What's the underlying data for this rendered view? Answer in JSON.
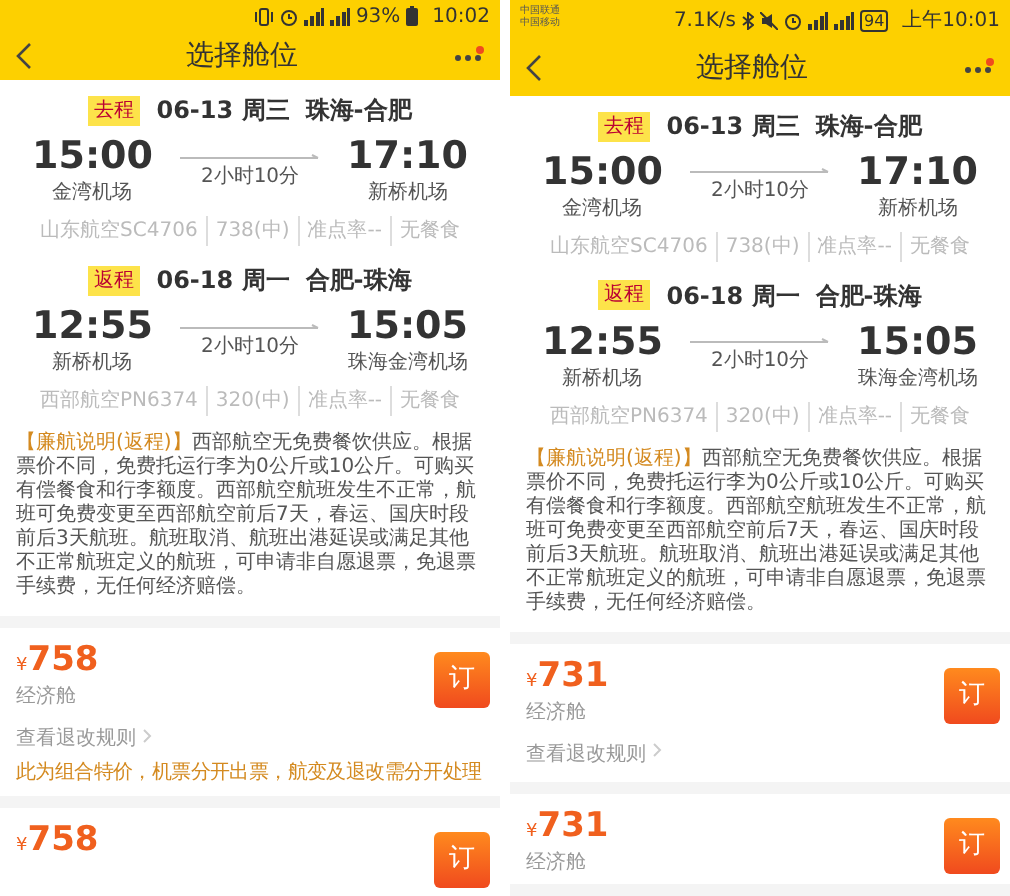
{
  "screens": [
    {
      "status_bar": {
        "kind": "simple",
        "battery": "93%",
        "time": "10:02"
      },
      "title": "选择舱位",
      "notification_dot": true,
      "legs": [
        {
          "tag": "去程",
          "date": "06-13 周三",
          "route": "珠海-合肥",
          "depart_time": "15:00",
          "depart_airport": "金湾机场",
          "duration": "2小时10分",
          "arrive_time": "17:10",
          "arrive_airport": "新桥机场",
          "details": [
            "山东航空SC4706",
            "738(中)",
            "准点率--",
            "无餐食"
          ]
        },
        {
          "tag": "返程",
          "date": "06-18 周一",
          "route": "合肥-珠海",
          "depart_time": "12:55",
          "depart_airport": "新桥机场",
          "duration": "2小时10分",
          "arrive_time": "15:05",
          "arrive_airport": "珠海金湾机场",
          "details": [
            "西部航空PN6374",
            "320(中)",
            "准点率--",
            "无餐食"
          ]
        }
      ],
      "notice": {
        "label": "【廉航说明(返程)】",
        "text": "西部航空无免费餐饮供应。根据票价不同，免费托运行李为0公斤或10公斤。可购买有偿餐食和行李额度。西部航空航班发生不正常，航班可免费变更至西部航空前后7天，春运、国庆时段前后3天航班。航班取消、航班出港延误或满足其他不正常航班定义的航班，可申请非自愿退票，免退票手续费，无任何经济赔偿。"
      },
      "fares": [
        {
          "currency": "¥",
          "price": "758",
          "cabin": "经济舱",
          "rules_link": "查看退改规则",
          "note": "此为组合特价，机票分开出票，航变及退改需分开处理",
          "book": "订"
        },
        {
          "currency": "¥",
          "price": "758",
          "book": "订"
        }
      ]
    },
    {
      "status_bar": {
        "kind": "detailed",
        "carriers": [
          "中国联通",
          "中国移动"
        ],
        "speed": "7.1K/s",
        "battery": "94",
        "time": "上午10:01"
      },
      "title": "选择舱位",
      "notification_dot": true,
      "legs": [
        {
          "tag": "去程",
          "date": "06-13 周三",
          "route": "珠海-合肥",
          "depart_time": "15:00",
          "depart_airport": "金湾机场",
          "duration": "2小时10分",
          "arrive_time": "17:10",
          "arrive_airport": "新桥机场",
          "details": [
            "山东航空SC4706",
            "738(中)",
            "准点率--",
            "无餐食"
          ]
        },
        {
          "tag": "返程",
          "date": "06-18 周一",
          "route": "合肥-珠海",
          "depart_time": "12:55",
          "depart_airport": "新桥机场",
          "duration": "2小时10分",
          "arrive_time": "15:05",
          "arrive_airport": "珠海金湾机场",
          "details": [
            "西部航空PN6374",
            "320(中)",
            "准点率--",
            "无餐食"
          ]
        }
      ],
      "notice": {
        "label": "【廉航说明(返程)】",
        "text": "西部航空无免费餐饮供应。根据票价不同，免费托运行李为0公斤或10公斤。可购买有偿餐食和行李额度。西部航空航班发生不正常，航班可免费变更至西部航空前后7天，春运、国庆时段前后3天航班。航班取消、航班出港延误或满足其他不正常航班定义的航班，可申请非自愿退票，免退票手续费，无任何经济赔偿。"
      },
      "fares": [
        {
          "currency": "¥",
          "price": "731",
          "cabin": "经济舱",
          "rules_link": "查看退改规则",
          "book": "订"
        },
        {
          "currency": "¥",
          "price": "731",
          "cabin": "经济舱",
          "book": "订"
        }
      ]
    }
  ]
}
